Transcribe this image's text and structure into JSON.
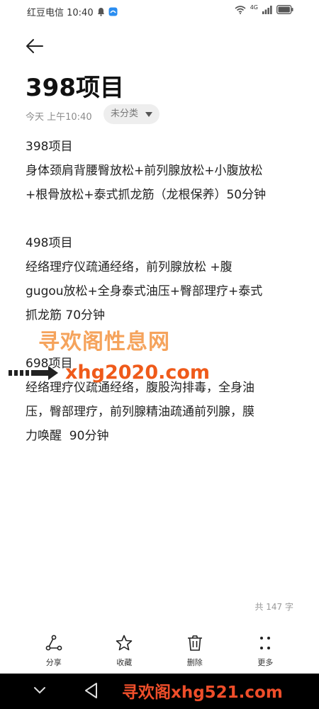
{
  "status_bar": {
    "carrier_time": "红豆电信 10:40",
    "network_label": "4G"
  },
  "note": {
    "title": "398项目",
    "timestamp": "今天 上午10:40",
    "category": "未分类",
    "lines": [
      "398项目",
      "身体颈肩背腰臀放松+前列腺放松+小腹放松",
      "+根骨放松+泰式抓龙筋（龙根保养）50分钟",
      "",
      "498项目",
      "经络理疗仪疏通经络，前列腺放松 +腹",
      "gugou放松+全身泰式油压+臀部理疗+泰式",
      "抓龙筋 70分钟",
      "",
      "698项目",
      "经络理疗仪疏通经络，腹股沟排毒，全身油",
      "压，臀部理疗，前列腺精油疏通前列腺，膜",
      "力唤醒  90分钟"
    ],
    "word_count": "共 147 字"
  },
  "watermarks": {
    "top": "寻欢阁性息网",
    "middle": "xhg2020.com",
    "bottom": "寻欢阁xhg521.com"
  },
  "toolbar": {
    "share": "分享",
    "favorite": "收藏",
    "delete": "删除",
    "more": "更多"
  },
  "colors": {
    "watermark_orange": "#f5a35c",
    "watermark_red": "#ef5a1a"
  }
}
